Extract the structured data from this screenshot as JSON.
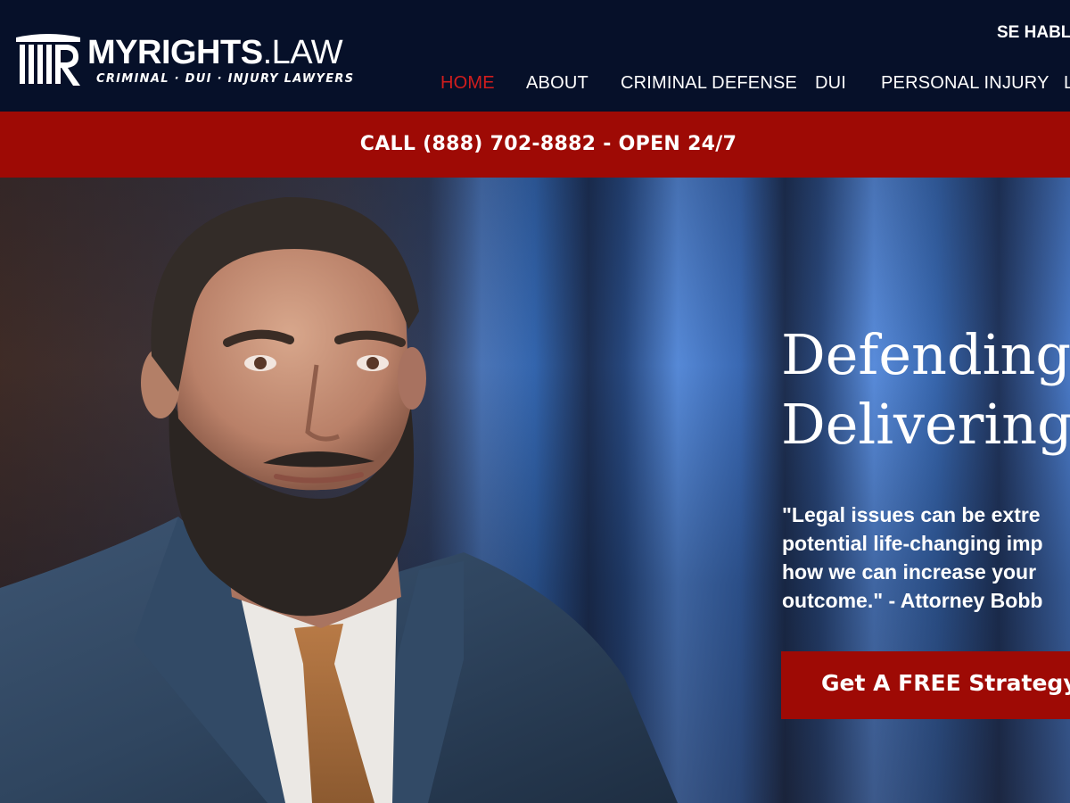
{
  "header": {
    "logo_name_bold": "MYRIGHTS",
    "logo_name_light": ".LAW",
    "logo_tagline": "CRIMINAL · DUI · INJURY LAWYERS",
    "spanish_link": "SE HABLA",
    "nav": [
      {
        "label": "HOME",
        "active": true
      },
      {
        "label": "ABOUT",
        "active": false
      },
      {
        "label": "CRIMINAL DEFENSE",
        "active": false
      },
      {
        "label": "DUI",
        "active": false
      },
      {
        "label": "PERSONAL INJURY",
        "active": false
      },
      {
        "label": "L",
        "active": false
      }
    ]
  },
  "callbar": {
    "text": "CALL (888) 702-8882 - OPEN 24/7"
  },
  "hero": {
    "headline_lines": [
      "Defending",
      "Delivering"
    ],
    "quote_lines": [
      "\"Legal issues can be extre",
      "potential life-changing imp",
      "how we can increase your",
      "outcome.\" - Attorney Bobb"
    ],
    "cta_label": "Get A FREE Strategy S"
  },
  "colors": {
    "header_bg": "#061029",
    "accent_red": "#9e0a05",
    "nav_active": "#d11d1d",
    "text": "#ffffff"
  }
}
